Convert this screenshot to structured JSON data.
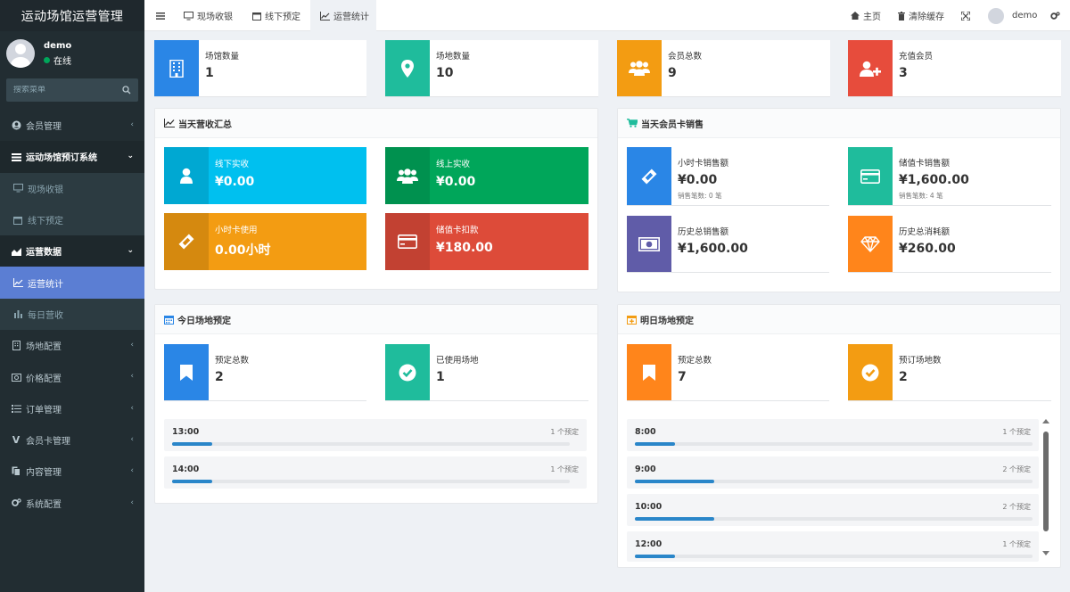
{
  "brand": "运动场馆运营管理",
  "user": {
    "name": "demo",
    "status": "在线"
  },
  "sidebar": {
    "search_placeholder": "搜索菜单",
    "items": [
      "会员管理",
      "运动场馆预订系统",
      "现场收银",
      "线下预定",
      "运营数据",
      "运营统计",
      "每日营收",
      "场地配置",
      "价格配置",
      "订单管理",
      "会员卡管理",
      "内容管理",
      "系统配置"
    ]
  },
  "topbar": {
    "tabs": [
      "现场收银",
      "线下预定",
      "运营统计"
    ],
    "home": "主页",
    "clear_cache": "清除缓存",
    "user": "demo"
  },
  "stats": [
    {
      "label": "场馆数量",
      "value": "1",
      "color": "#2a86e6"
    },
    {
      "label": "场地数量",
      "value": "10",
      "color": "#1fbc9c"
    },
    {
      "label": "会员总数",
      "value": "9",
      "color": "#f39c12"
    },
    {
      "label": "充值会员",
      "value": "3",
      "color": "#e74c3c"
    }
  ],
  "revenue": {
    "title": "当天营收汇总",
    "boxes": [
      {
        "label": "线下实收",
        "value": "¥0.00",
        "color": "#00c0ef"
      },
      {
        "label": "线上实收",
        "value": "¥0.00",
        "color": "#00a65a"
      },
      {
        "label": "小时卡使用",
        "value": "0.00小时",
        "color": "#f39c12"
      },
      {
        "label": "储值卡扣款",
        "value": "¥180.00",
        "color": "#dd4b39"
      }
    ]
  },
  "cards": {
    "title": "当天会员卡销售",
    "items": [
      {
        "label": "小时卡销售额",
        "value": "¥0.00",
        "sub": "销售笔数: 0 笔",
        "color": "#2a86e6"
      },
      {
        "label": "储值卡销售额",
        "value": "¥1,600.00",
        "sub": "销售笔数: 4 笔",
        "color": "#1fbc9c"
      },
      {
        "label": "历史总销售额",
        "value": "¥1,600.00",
        "sub": "",
        "color": "#605ca8"
      },
      {
        "label": "历史总消耗额",
        "value": "¥260.00",
        "sub": "",
        "color": "#ff851b"
      }
    ]
  },
  "today": {
    "title": "今日场地预定",
    "stats": [
      {
        "label": "预定总数",
        "value": "2",
        "color": "#2a86e6"
      },
      {
        "label": "已使用场地",
        "value": "1",
        "color": "#1fbc9c"
      }
    ],
    "slots": [
      {
        "time": "13:00",
        "count": "1 个预定",
        "pct": 10
      },
      {
        "time": "14:00",
        "count": "1 个预定",
        "pct": 10
      }
    ]
  },
  "tomorrow": {
    "title": "明日场地预定",
    "stats": [
      {
        "label": "预定总数",
        "value": "7",
        "color": "#ff851b"
      },
      {
        "label": "预订场地数",
        "value": "2",
        "color": "#f39c12"
      }
    ],
    "slots": [
      {
        "time": "8:00",
        "count": "1 个预定",
        "pct": 10
      },
      {
        "time": "9:00",
        "count": "2 个预定",
        "pct": 20
      },
      {
        "time": "10:00",
        "count": "2 个预定",
        "pct": 20
      },
      {
        "time": "12:00",
        "count": "1 个预定",
        "pct": 10
      }
    ]
  }
}
